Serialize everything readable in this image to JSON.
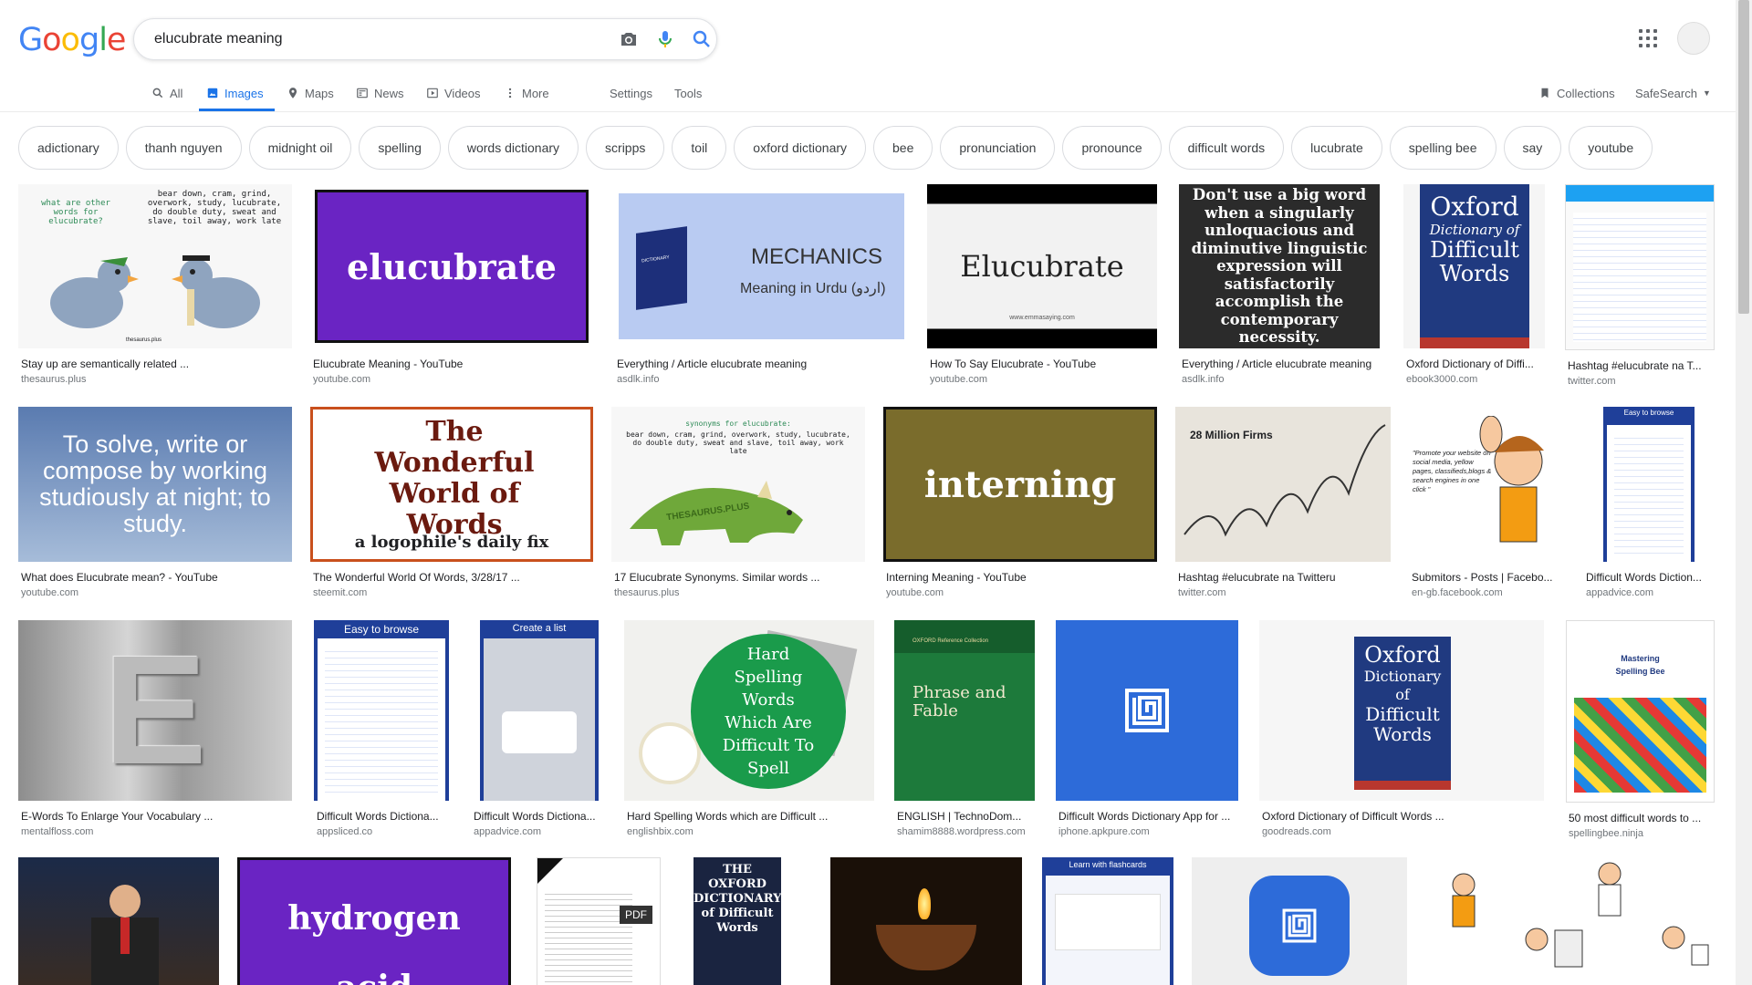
{
  "query": "elucubrate meaning",
  "logo_letters": [
    "G",
    "o",
    "o",
    "g",
    "l",
    "e"
  ],
  "tabs": {
    "all": "All",
    "images": "Images",
    "maps": "Maps",
    "news": "News",
    "videos": "Videos",
    "more": "More",
    "settings": "Settings",
    "tools": "Tools",
    "collections": "Collections",
    "safesearch": "SafeSearch"
  },
  "chips": [
    "adictionary",
    "thanh nguyen",
    "midnight oil",
    "spelling",
    "words dictionary",
    "scripps",
    "toil",
    "oxford dictionary",
    "bee",
    "pronunciation",
    "pronounce",
    "difficult words",
    "lucubrate",
    "spelling bee",
    "say",
    "youtube"
  ],
  "thumb_text": {
    "pigeons_q": "what are other words for elucubrate?",
    "pigeons_a": "bear down, cram, grind, overwork, study, lucubrate, do double duty, sweat and slave, toil away, work late",
    "pigeons_logo": "thesaurus.plus",
    "elucubrate": "elucubrate",
    "mechanics": "MECHANICS",
    "urdu": "Meaning in Urdu (اردو)",
    "dict_spine": "DICTIONARY",
    "elucubrate_cap": "Elucubrate",
    "emma": "www.emmasaying.com",
    "bigword": "Don't use a big word when a singularly unloquacious and diminutive linguistic expression will satisfactorily accomplish the contemporary necessity.",
    "oxford": "Oxford",
    "dict_of": "Dictionary of",
    "difficult_words": "Difficult Words",
    "solve": "To solve, write or compose by working studiously at night; to study.",
    "wonderful": "The Wonderful World of Words",
    "logophile": "a logophile's daily fix",
    "syn_title": "synonyms for elucubrate:",
    "syn_list": "bear down, cram, grind, overwork, study, lucubrate, do double duty, sweat and slave, toil away, work late",
    "thesaurus_plus": "THESAURUS.PLUS",
    "interning": "interning",
    "million": "28 Million Firms",
    "promote": "\"Promote your website on social media, yellow pages, classifieds,blogs & search engines in one click \"",
    "easy": "Easy to browse",
    "create": "Create a list",
    "E": "E",
    "hard_spelling": "Hard Spelling Words Which Are Difficult To Spell",
    "oxford_ref": "OXFORD Reference Collection",
    "phrase_fable": "Phrase and Fable",
    "mastering": "Mastering",
    "spelling_bee": "Spelling Bee",
    "hydrogen": "hydrogen acid",
    "pdf": "PDF",
    "oxford_dict": "THE OXFORD DICTIONARY of Difficult Words",
    "learn": "Learn with flashcards"
  },
  "results": [
    {
      "title": "Stay up are semantically related ...",
      "source": "thesaurus.plus"
    },
    {
      "title": "Elucubrate Meaning - YouTube",
      "source": "youtube.com"
    },
    {
      "title": "Everything / Article elucubrate meaning",
      "source": "asdlk.info"
    },
    {
      "title": "How To Say Elucubrate - YouTube",
      "source": "youtube.com"
    },
    {
      "title": "Everything / Article elucubrate meaning",
      "source": "asdlk.info"
    },
    {
      "title": "Oxford Dictionary of Diffi...",
      "source": "ebook3000.com"
    },
    {
      "title": "Hashtag #elucubrate na T...",
      "source": "twitter.com"
    },
    {
      "title": "What does Elucubrate mean? - YouTube",
      "source": "youtube.com"
    },
    {
      "title": "The Wonderful World Of Words, 3/28/17 ...",
      "source": "steemit.com"
    },
    {
      "title": "17 Elucubrate Synonyms. Similar words ...",
      "source": "thesaurus.plus"
    },
    {
      "title": "Interning Meaning - YouTube",
      "source": "youtube.com"
    },
    {
      "title": "Hashtag #elucubrate na Twitteru",
      "source": "twitter.com"
    },
    {
      "title": "Submitors - Posts | Facebo...",
      "source": "en-gb.facebook.com"
    },
    {
      "title": "Difficult Words Diction...",
      "source": "appadvice.com"
    },
    {
      "title": "E-Words To Enlarge Your Vocabulary ...",
      "source": "mentalfloss.com"
    },
    {
      "title": "Difficult Words Dictiona...",
      "source": "appsliced.co"
    },
    {
      "title": "Difficult Words Dictiona...",
      "source": "appadvice.com"
    },
    {
      "title": "Hard Spelling Words which are Difficult ...",
      "source": "englishbix.com"
    },
    {
      "title": "ENGLISH | TechnoDom...",
      "source": "shamim8888.wordpress.com"
    },
    {
      "title": "Difficult Words Dictionary App for ...",
      "source": "iphone.apkpure.com"
    },
    {
      "title": "Oxford Dictionary of Difficult Words ...",
      "source": "goodreads.com"
    },
    {
      "title": "50 most difficult words to ...",
      "source": "spellingbee.ninja"
    }
  ]
}
